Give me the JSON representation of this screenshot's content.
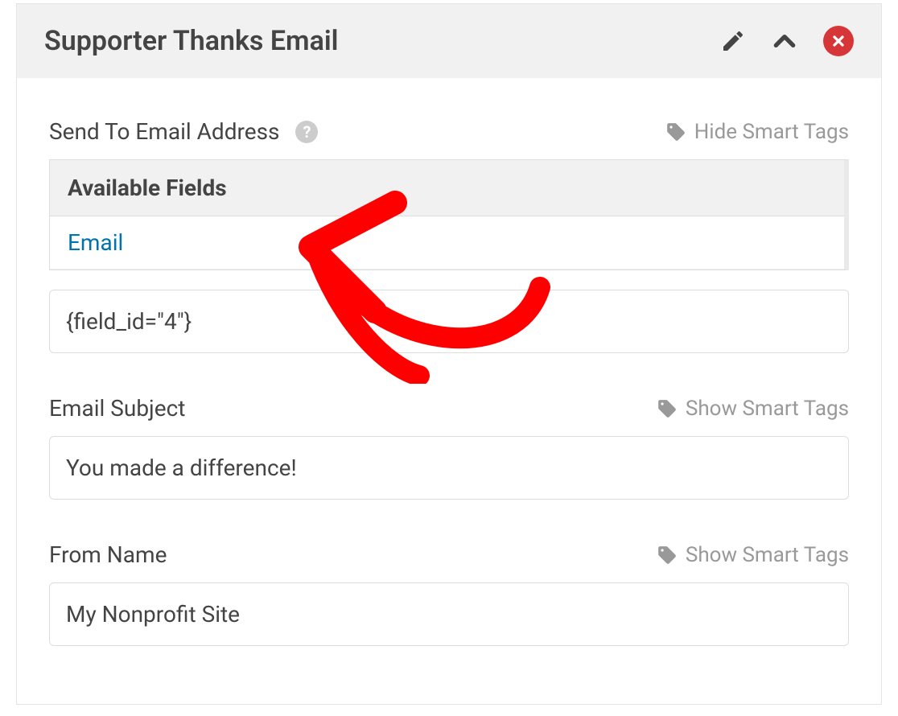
{
  "panel": {
    "title": "Supporter Thanks Email"
  },
  "sections": {
    "send_to": {
      "label": "Send To Email Address",
      "smart_tags_label": "Hide Smart Tags",
      "available_header": "Available Fields",
      "available_items": [
        "Email"
      ],
      "value": "{field_id=\"4\"}"
    },
    "subject": {
      "label": "Email Subject",
      "smart_tags_label": "Show Smart Tags",
      "value": "You made a difference!"
    },
    "from_name": {
      "label": "From Name",
      "smart_tags_label": "Show Smart Tags",
      "value": "My Nonprofit Site"
    }
  }
}
